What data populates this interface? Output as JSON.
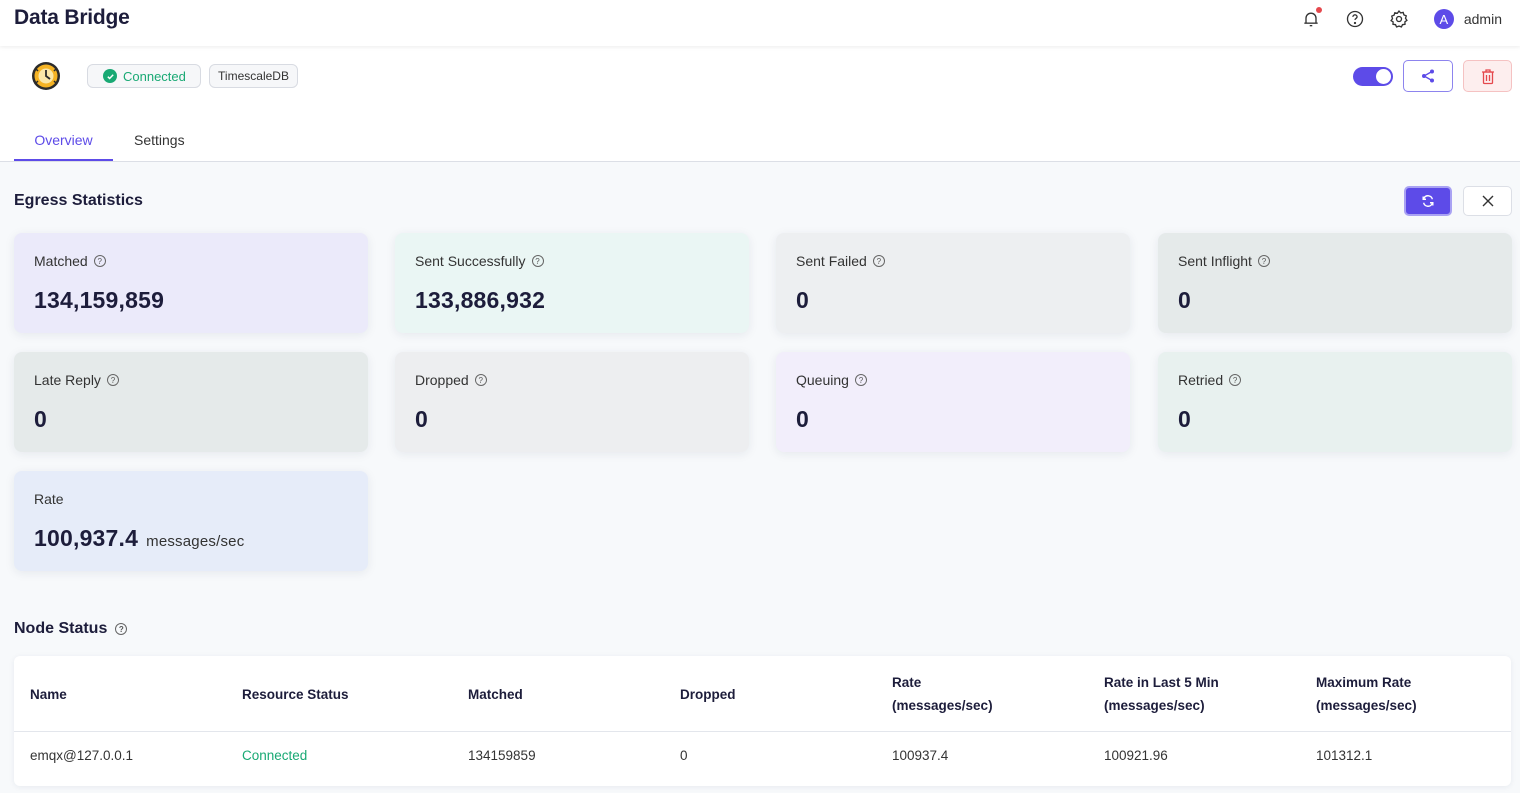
{
  "app": {
    "title": "Data Bridge"
  },
  "topbar": {
    "username": "admin",
    "avatar_initial": "A",
    "notifications_unread": true
  },
  "bridge": {
    "status_badge": "Connected",
    "type_badge": "TimescaleDB",
    "enabled": true
  },
  "tabs": [
    {
      "label": "Overview",
      "active": true
    },
    {
      "label": "Settings",
      "active": false
    }
  ],
  "egress": {
    "title": "Egress Statistics",
    "cards": [
      {
        "label": "Matched",
        "value": "134,159,859"
      },
      {
        "label": "Sent Successfully",
        "value": "133,886,932"
      },
      {
        "label": "Sent Failed",
        "value": "0"
      },
      {
        "label": "Sent Inflight",
        "value": "0"
      },
      {
        "label": "Late Reply",
        "value": "0"
      },
      {
        "label": "Dropped",
        "value": "0"
      },
      {
        "label": "Queuing",
        "value": "0"
      },
      {
        "label": "Retried",
        "value": "0"
      },
      {
        "label": "Rate",
        "value": "100,937.4",
        "unit": "messages/sec"
      }
    ]
  },
  "node_status": {
    "title": "Node Status",
    "columns": [
      {
        "line1": "Name"
      },
      {
        "line1": "Resource Status"
      },
      {
        "line1": "Matched"
      },
      {
        "line1": "Dropped"
      },
      {
        "line1": "Rate",
        "line2": "(messages/sec)"
      },
      {
        "line1": "Rate in Last 5 Min",
        "line2": "(messages/sec)"
      },
      {
        "line1": "Maximum Rate",
        "line2": "(messages/sec)"
      }
    ],
    "rows": [
      [
        "emqx@127.0.0.1",
        "Connected",
        "134159859",
        "0",
        "100937.4",
        "100921.96",
        "101312.1"
      ]
    ]
  },
  "colors": {
    "accent": "#5d4be8",
    "success": "#19a974",
    "danger": "#e5484d"
  }
}
